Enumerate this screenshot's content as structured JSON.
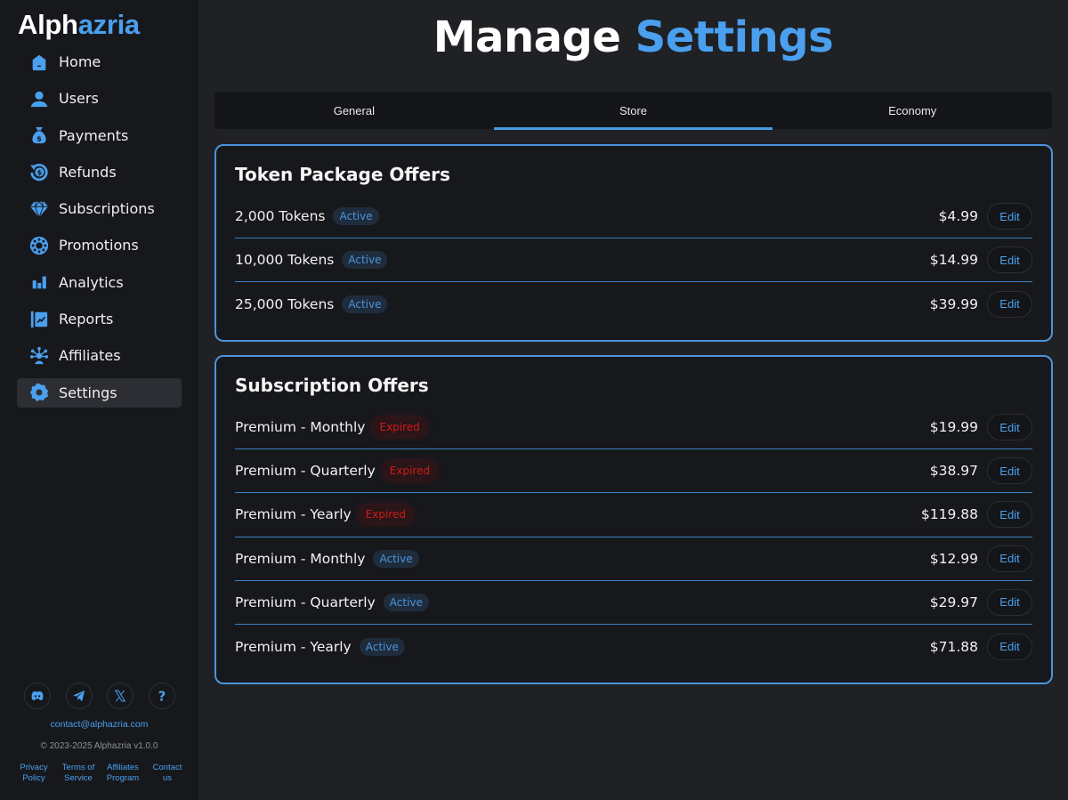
{
  "brand": {
    "part1": "Alph",
    "part2": "azria"
  },
  "sidebar": {
    "items": [
      {
        "label": "Home",
        "icon": "home-icon"
      },
      {
        "label": "Users",
        "icon": "user-icon"
      },
      {
        "label": "Payments",
        "icon": "money-bag-icon"
      },
      {
        "label": "Refunds",
        "icon": "refund-icon"
      },
      {
        "label": "Subscriptions",
        "icon": "diamond-icon"
      },
      {
        "label": "Promotions",
        "icon": "promotion-icon"
      },
      {
        "label": "Analytics",
        "icon": "bar-chart-icon"
      },
      {
        "label": "Reports",
        "icon": "report-icon"
      },
      {
        "label": "Affiliates",
        "icon": "affiliates-icon"
      },
      {
        "label": "Settings",
        "icon": "gear-icon",
        "active": true
      }
    ],
    "social": [
      "discord-icon",
      "telegram-icon",
      "x-icon",
      "help-icon"
    ],
    "email": "contact@alphazria.com",
    "copyright": "© 2023-2025 Alphazria v1.0.0",
    "footer_links": [
      {
        "line1": "Privacy",
        "line2": "Policy"
      },
      {
        "line1": "Terms of",
        "line2": "Service"
      },
      {
        "line1": "Affiliates",
        "line2": "Program"
      },
      {
        "line1": "Contact",
        "line2": "us"
      }
    ]
  },
  "header": {
    "title_part1": "Manage",
    "title_part2": "Settings"
  },
  "tabs": [
    {
      "label": "General"
    },
    {
      "label": "Store",
      "active": true
    },
    {
      "label": "Economy"
    }
  ],
  "token_offers": {
    "title": "Token Package Offers",
    "rows": [
      {
        "name": "2,000 Tokens",
        "status": "Active",
        "price": "$4.99",
        "action": "Edit"
      },
      {
        "name": "10,000 Tokens",
        "status": "Active",
        "price": "$14.99",
        "action": "Edit"
      },
      {
        "name": "25,000 Tokens",
        "status": "Active",
        "price": "$39.99",
        "action": "Edit"
      }
    ]
  },
  "subscription_offers": {
    "title": "Subscription Offers",
    "rows": [
      {
        "name": "Premium - Monthly",
        "status": "Expired",
        "price": "$19.99",
        "action": "Edit"
      },
      {
        "name": "Premium - Quarterly",
        "status": "Expired",
        "price": "$38.97",
        "action": "Edit"
      },
      {
        "name": "Premium - Yearly",
        "status": "Expired",
        "price": "$119.88",
        "action": "Edit"
      },
      {
        "name": "Premium - Monthly",
        "status": "Active",
        "price": "$12.99",
        "action": "Edit"
      },
      {
        "name": "Premium - Quarterly",
        "status": "Active",
        "price": "$29.97",
        "action": "Edit"
      },
      {
        "name": "Premium - Yearly",
        "status": "Active",
        "price": "$71.88",
        "action": "Edit"
      }
    ]
  },
  "colors": {
    "accent": "#4aa0ef",
    "expired": "#d11a1a",
    "background": "#1f2125",
    "sidebar": "#17181c"
  }
}
